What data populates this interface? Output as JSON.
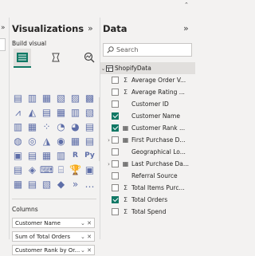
{
  "top_caret": "⌃",
  "left_strip": {
    "collapse_glyph": "»"
  },
  "visualizations": {
    "title": "Visualizations",
    "collapse_glyph": "»",
    "build_label": "Build visual",
    "columns_label": "Columns",
    "columns_wells": [
      {
        "label": "Customer Name",
        "controls": "⌄ ✕"
      },
      {
        "label": "Sum of Total Orders",
        "controls": "⌄ ✕"
      },
      {
        "label": "Customer Rank by Or...",
        "controls": "⌄ ✕"
      }
    ],
    "grid_icons": [
      "▤",
      "▥",
      "▦",
      "▧",
      "▨",
      "▩",
      "⩘",
      "◭",
      "▤",
      "▦",
      "▥",
      "▧",
      "▥",
      "▦",
      "⁘",
      "◔",
      "◕",
      "▤",
      "◍",
      "◎",
      "◮",
      "◉",
      "▦",
      "▤",
      "▣",
      "▤",
      "▦",
      "▥",
      "R",
      "Py",
      "▤",
      "◈",
      "⌨",
      "⌸",
      "🏆",
      "▣",
      "▦",
      "▤",
      "▧",
      "◆",
      "»",
      "…"
    ],
    "accent_color": "#117865"
  },
  "data_pane": {
    "title": "Data",
    "collapse_glyph": "»",
    "search_placeholder": "Search",
    "table_name": "ShopifyData",
    "fields": [
      {
        "label": "Average Order V...",
        "sigma": true,
        "checked": false,
        "expand": false
      },
      {
        "label": "Average Rating ...",
        "sigma": true,
        "checked": false,
        "expand": false
      },
      {
        "label": "Customer ID",
        "sigma": false,
        "checked": false,
        "expand": false
      },
      {
        "label": "Customer Name",
        "sigma": false,
        "checked": true,
        "expand": false
      },
      {
        "label": "Customer Rank ...",
        "sigma": false,
        "checked": true,
        "expand": false,
        "icon": "calendar"
      },
      {
        "label": "First Purchase D...",
        "sigma": false,
        "checked": false,
        "expand": true,
        "icon": "calendar"
      },
      {
        "label": "Geographical Lo...",
        "sigma": false,
        "checked": false,
        "expand": false
      },
      {
        "label": "Last Purchase Da...",
        "sigma": false,
        "checked": false,
        "expand": true,
        "icon": "calendar"
      },
      {
        "label": "Referral Source",
        "sigma": false,
        "checked": false,
        "expand": false
      },
      {
        "label": "Total Items Purc...",
        "sigma": true,
        "checked": false,
        "expand": false
      },
      {
        "label": "Total Orders",
        "sigma": true,
        "checked": true,
        "expand": false
      },
      {
        "label": "Total Spend",
        "sigma": true,
        "checked": false,
        "expand": false
      }
    ]
  }
}
